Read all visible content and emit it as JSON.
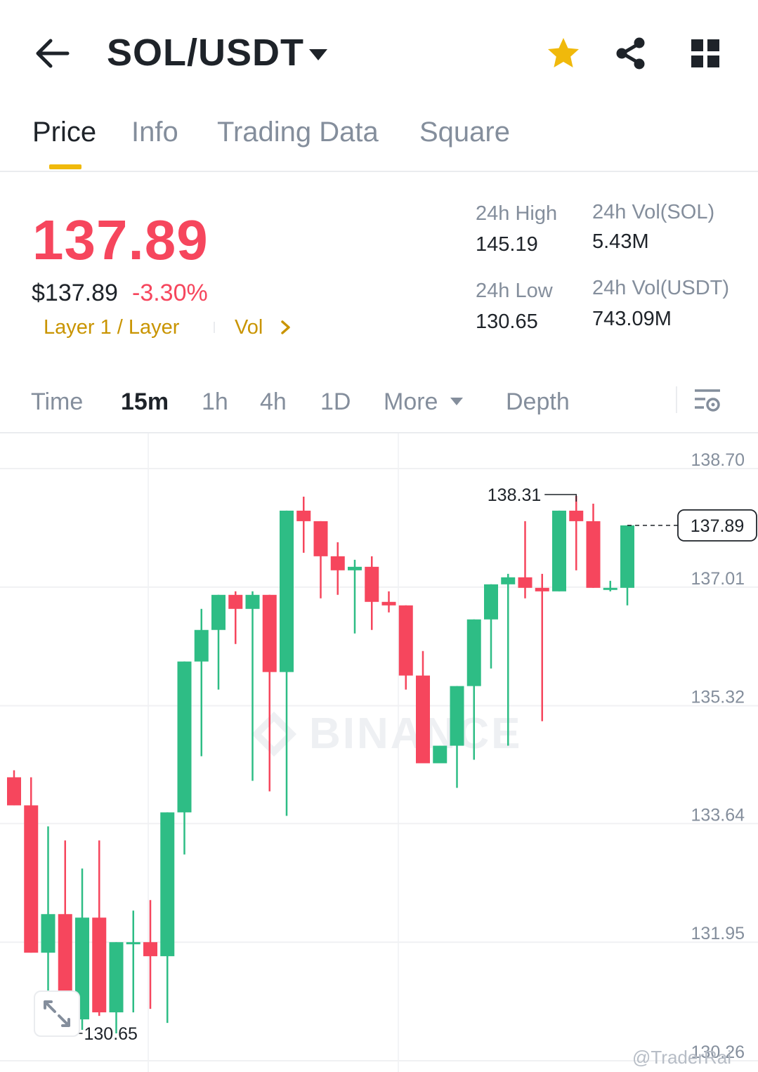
{
  "header": {
    "pair": "SOL/USDT",
    "icons": [
      "back-arrow-icon",
      "caret-down-icon",
      "star-icon",
      "share-icon",
      "grid-icon"
    ],
    "favorite_color": "#F0B90B"
  },
  "tabs": [
    {
      "label": "Price",
      "active": true
    },
    {
      "label": "Info"
    },
    {
      "label": "Trading Data"
    },
    {
      "label": "Square"
    }
  ],
  "price": {
    "last": "137.89",
    "usd": "$137.89",
    "change": "-3.30%",
    "tags": [
      "Layer 1 / Layer",
      "Vol"
    ],
    "color_down": "#F6465D",
    "color_up": "#2EBD85"
  },
  "stats": {
    "high_label": "24h High",
    "high_value": "145.19",
    "low_label": "24h Low",
    "low_value": "130.65",
    "vol_base_label": "24h Vol(SOL)",
    "vol_base_value": "5.43M",
    "vol_quote_label": "24h Vol(USDT)",
    "vol_quote_value": "743.09M"
  },
  "intervals": {
    "items": [
      "Time",
      "15m",
      "1h",
      "4h",
      "1D",
      "More",
      "Depth"
    ],
    "active": "15m"
  },
  "chart": {
    "watermark": "BINANCE",
    "credit": "@TraderRai",
    "current_price": "137.89"
  },
  "chart_data": {
    "type": "candlestick",
    "interval": "15m",
    "y_ticks": [
      "138.70",
      "137.01",
      "135.32",
      "133.64",
      "131.95",
      "130.26"
    ],
    "y_range": [
      130.26,
      138.7
    ],
    "max_marker": "138.31",
    "min_marker": "130.65",
    "last_price": 137.89,
    "candles": [
      {
        "o": 134.3,
        "h": 134.4,
        "l": 133.9,
        "c": 133.9
      },
      {
        "o": 133.9,
        "h": 134.3,
        "l": 131.8,
        "c": 131.8
      },
      {
        "o": 131.8,
        "h": 133.6,
        "l": 130.6,
        "c": 132.35
      },
      {
        "o": 132.35,
        "h": 133.4,
        "l": 130.9,
        "c": 130.85
      },
      {
        "o": 130.85,
        "h": 133.0,
        "l": 130.7,
        "c": 132.3
      },
      {
        "o": 132.3,
        "h": 133.4,
        "l": 130.9,
        "c": 130.95
      },
      {
        "o": 130.95,
        "h": 131.95,
        "l": 130.65,
        "c": 131.95
      },
      {
        "o": 131.95,
        "h": 132.4,
        "l": 130.95,
        "c": 131.95
      },
      {
        "o": 131.95,
        "h": 132.55,
        "l": 131.0,
        "c": 131.75
      },
      {
        "o": 131.75,
        "h": 133.8,
        "l": 130.8,
        "c": 133.8
      },
      {
        "o": 133.8,
        "h": 135.95,
        "l": 133.2,
        "c": 135.95
      },
      {
        "o": 135.95,
        "h": 136.7,
        "l": 134.6,
        "c": 136.4
      },
      {
        "o": 136.4,
        "h": 136.7,
        "l": 135.55,
        "c": 136.9
      },
      {
        "o": 136.9,
        "h": 136.95,
        "l": 136.2,
        "c": 136.7
      },
      {
        "o": 136.7,
        "h": 136.95,
        "l": 134.25,
        "c": 136.9
      },
      {
        "o": 136.9,
        "h": 135.9,
        "l": 134.1,
        "c": 135.8
      },
      {
        "o": 135.8,
        "h": 138.1,
        "l": 133.75,
        "c": 138.1
      },
      {
        "o": 138.1,
        "h": 138.3,
        "l": 137.5,
        "c": 137.95
      },
      {
        "o": 137.95,
        "h": 137.65,
        "l": 136.85,
        "c": 137.45
      },
      {
        "o": 137.45,
        "h": 137.65,
        "l": 136.9,
        "c": 137.25
      },
      {
        "o": 137.25,
        "h": 137.4,
        "l": 136.35,
        "c": 137.3
      },
      {
        "o": 137.3,
        "h": 137.45,
        "l": 136.4,
        "c": 136.8
      },
      {
        "o": 136.8,
        "h": 136.95,
        "l": 136.65,
        "c": 136.75
      },
      {
        "o": 136.75,
        "h": 136.6,
        "l": 135.55,
        "c": 135.75
      },
      {
        "o": 135.75,
        "h": 136.1,
        "l": 134.8,
        "c": 134.5
      },
      {
        "o": 134.5,
        "h": 134.75,
        "l": 134.55,
        "c": 134.75
      },
      {
        "o": 134.75,
        "h": 135.4,
        "l": 134.15,
        "c": 135.6
      },
      {
        "o": 135.6,
        "h": 136.2,
        "l": 134.55,
        "c": 136.55
      },
      {
        "o": 136.55,
        "h": 136.85,
        "l": 135.85,
        "c": 137.05
      },
      {
        "o": 137.05,
        "h": 137.2,
        "l": 134.75,
        "c": 137.15
      },
      {
        "o": 137.15,
        "h": 137.95,
        "l": 136.85,
        "c": 137.0
      },
      {
        "o": 137.0,
        "h": 137.2,
        "l": 135.1,
        "c": 136.95
      },
      {
        "o": 136.95,
        "h": 138.1,
        "l": 137.35,
        "c": 138.1
      },
      {
        "o": 138.1,
        "h": 138.31,
        "l": 137.25,
        "c": 137.95
      },
      {
        "o": 137.95,
        "h": 138.2,
        "l": 137.1,
        "c": 137.0
      },
      {
        "o": 137.0,
        "h": 137.1,
        "l": 136.95,
        "c": 137.0
      },
      {
        "o": 137.0,
        "h": 137.4,
        "l": 136.75,
        "c": 137.89
      }
    ]
  }
}
